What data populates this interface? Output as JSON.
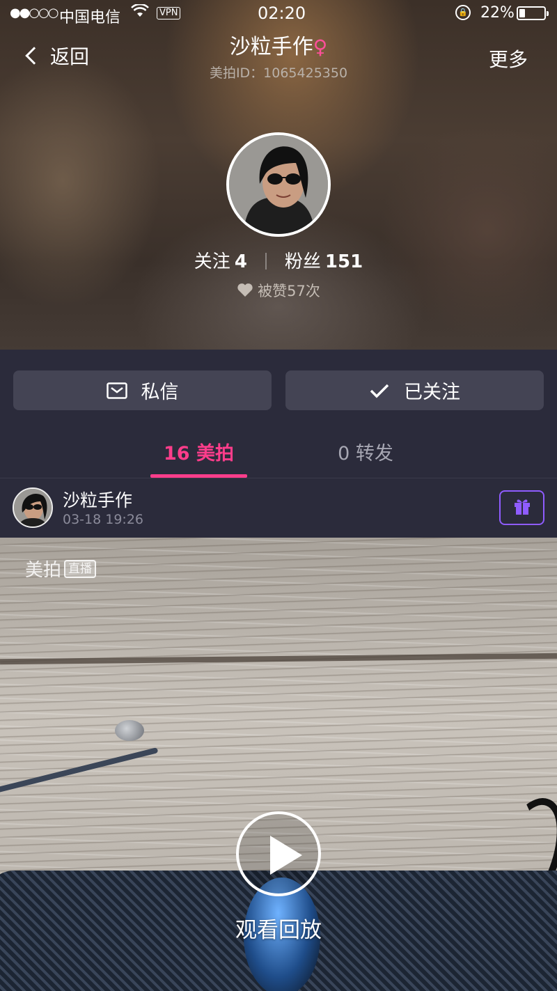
{
  "status_bar": {
    "signal": "●●○○○",
    "carrier": "中国电信",
    "vpn": "VPN",
    "time": "02:20",
    "battery_pct": "22%"
  },
  "nav": {
    "back_label": "返回",
    "title": "沙粒手作",
    "gender_symbol": "♀",
    "subtitle": "美拍ID：1065425350",
    "more_label": "更多"
  },
  "profile": {
    "following_label": "关注",
    "following_count": "4",
    "fans_label": "粉丝",
    "fans_count": "151",
    "likes_text": "被赞57次"
  },
  "actions": {
    "message_label": "私信",
    "follow_label": "已关注"
  },
  "tabs": {
    "meipai": "16 美拍",
    "repost": "0 转发"
  },
  "post": {
    "author": "沙粒手作",
    "time": "03-18 19:26",
    "watermark_brand": "美拍",
    "watermark_live": "直播",
    "replay_label": "观看回放"
  },
  "colors": {
    "accent": "#ff3d8b",
    "gift": "#8f5cff",
    "dark_bg": "#2b2b3b",
    "button_bg": "#444454"
  },
  "icons": {
    "back": "chevron-left-icon",
    "heart": "heart-icon",
    "message": "envelope-icon",
    "follow": "checkmark-icon",
    "gift": "gift-icon",
    "play": "play-icon"
  }
}
